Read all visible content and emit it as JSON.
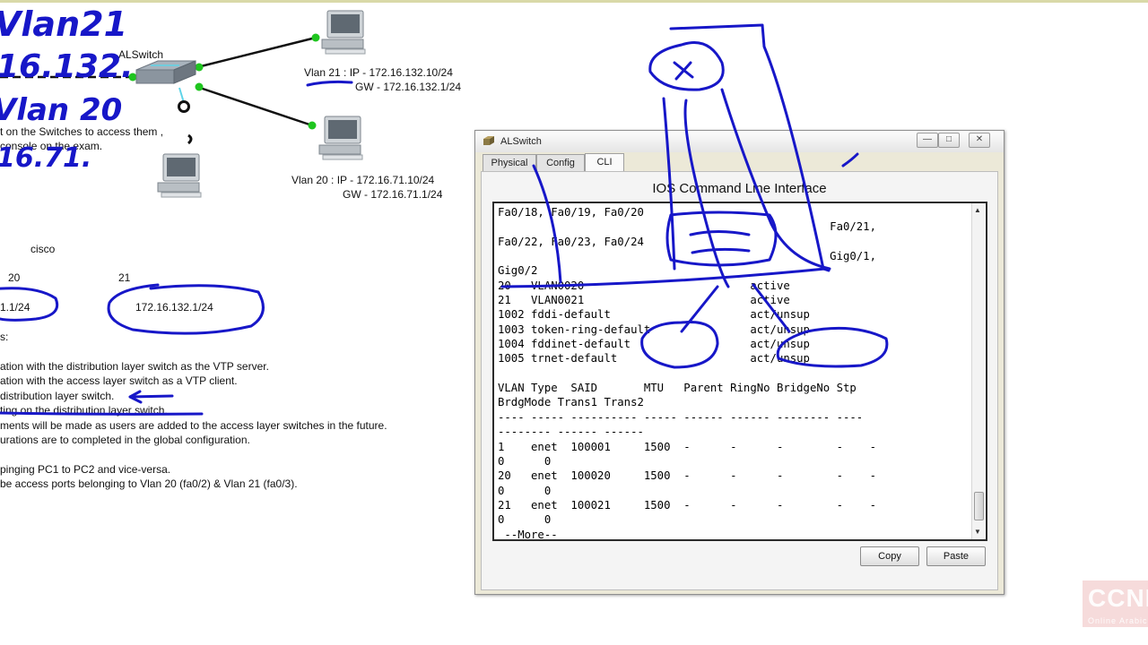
{
  "topology": {
    "switch_label": "ALSwitch",
    "pc1": {
      "line1": "Vlan 21 : IP   - 172.16.132.10/24",
      "line2": "GW - 172.16.132.1/24"
    },
    "pc2": {
      "line1": "Vlan 20 : IP   - 172.16.71.10/24",
      "line2": "GW - 172.16.71.1/24"
    },
    "note_line1": "t on the Switches to access them ,",
    "note_line2": "console on the exam."
  },
  "table": {
    "label": "cisco",
    "col1_header": "20",
    "col2_header": "21",
    "col1_value": "1.1/24",
    "col2_value": "172.16.132.1/24"
  },
  "requirements": {
    "heading": "s:",
    "lines": [
      "ation with the distribution layer switch as the VTP server.",
      "ation with the access layer switch as a VTP client.",
      "distribution layer switch.",
      "ting on the distribution layer switch.",
      "ments will be made as users are added to the access layer switches in the future.",
      "urations are to completed in the global configuration.",
      "",
      "pinging PC1 to PC2 and vice-versa.",
      "be access ports belonging to Vlan 20 (fa0/2) & Vlan 21 (fa0/3)."
    ]
  },
  "handwriting": {
    "line1": "Vlan21",
    "line2": "16.132.",
    "line3": "Vlan 20",
    "line4": "16.71."
  },
  "window": {
    "title": "ALSwitch",
    "min_glyph": "—",
    "max_glyph": "□",
    "close_glyph": "✕",
    "tabs": [
      "Physical",
      "Config",
      "CLI"
    ],
    "active_tab": "CLI",
    "heading": "IOS Command Line Interface",
    "terminal_lines": [
      "Fa0/18, Fa0/19, Fa0/20",
      "                                                  Fa0/21,",
      "Fa0/22, Fa0/23, Fa0/24",
      "                                                  Gig0/1,",
      "Gig0/2",
      "20   VLAN0020                         active",
      "21   VLAN0021                         active",
      "1002 fddi-default                     act/unsup",
      "1003 token-ring-default               act/unsup",
      "1004 fddinet-default                  act/unsup",
      "1005 trnet-default                    act/unsup",
      "",
      "VLAN Type  SAID       MTU   Parent RingNo BridgeNo Stp",
      "BrdgMode Trans1 Trans2",
      "---- ----- ---------- ----- ------ ------ -------- ----",
      "-------- ------ ------",
      "1    enet  100001     1500  -      -      -        -    -",
      "0      0",
      "20   enet  100020     1500  -      -      -        -    -",
      "0      0",
      "21   enet  100021     1500  -      -      -        -    -",
      "0      0",
      " --More--"
    ],
    "scroll_up_glyph": "▲",
    "scroll_down_glyph": "▼",
    "copy_label": "Copy",
    "paste_label": "Paste"
  },
  "watermark": {
    "main": "CCNP",
    "sub": "Online Arabic"
  },
  "colors": {
    "annotation_ink": "#1717c8",
    "link_green": "#1fc51f",
    "window_bg": "#ece9d8"
  },
  "icons": [
    "pc-icon",
    "switch-icon",
    "app-icon",
    "minimize-icon",
    "maximize-icon",
    "close-icon",
    "scroll-up-icon",
    "scroll-down-icon"
  ]
}
